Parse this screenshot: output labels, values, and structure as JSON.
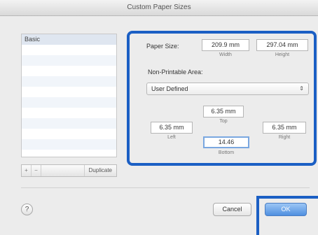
{
  "window": {
    "title": "Custom Paper Sizes"
  },
  "list": {
    "items": [
      "Basic"
    ],
    "toolbar": {
      "add": "+",
      "remove": "−",
      "duplicate": "Duplicate"
    }
  },
  "paper_size": {
    "label": "Paper Size:",
    "width": {
      "value": "209.9 mm",
      "caption": "Width"
    },
    "height": {
      "value": "297.04 mm",
      "caption": "Height"
    }
  },
  "non_printable": {
    "label": "Non-Printable Area:",
    "selected": "User Defined",
    "top": {
      "value": "6.35 mm",
      "caption": "Top"
    },
    "left": {
      "value": "6.35 mm",
      "caption": "Left"
    },
    "right": {
      "value": "6.35 mm",
      "caption": "Right"
    },
    "bottom": {
      "value": "14.46",
      "caption": "Bottom"
    }
  },
  "footer": {
    "help": "?",
    "cancel": "Cancel",
    "ok": "OK"
  },
  "colors": {
    "highlight": "#1b5fc4",
    "ok_button": "#4f8fe0"
  }
}
